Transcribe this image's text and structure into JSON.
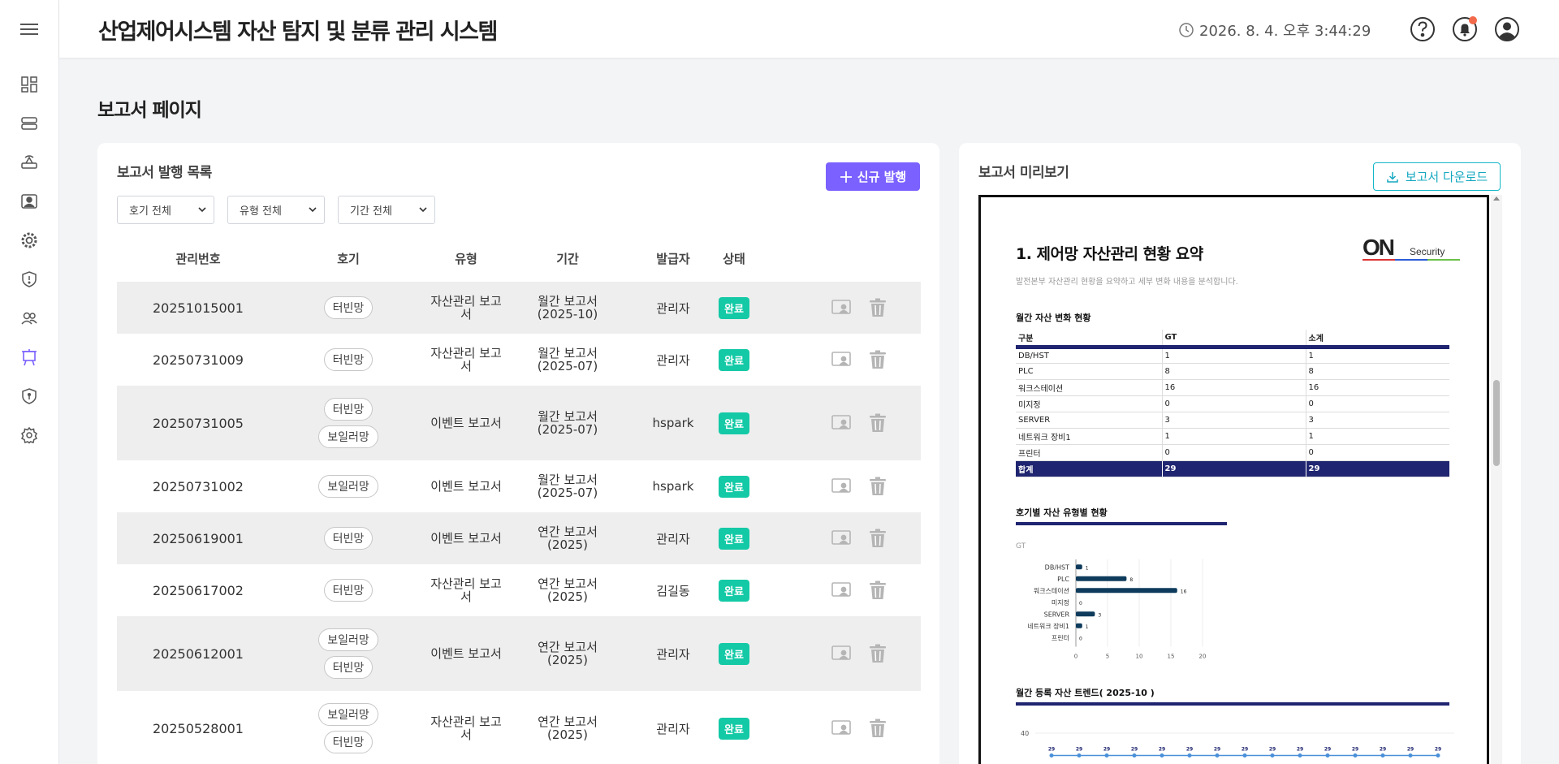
{
  "header": {
    "title": "산업제어시스템 자산 탐지 및 분류 관리 시스템",
    "datetime": "2026. 8. 4. 오후 3:44:29"
  },
  "sidebar": {
    "items": [
      {
        "icon": "dashboard-icon"
      },
      {
        "icon": "server-list-icon"
      },
      {
        "icon": "router-icon"
      },
      {
        "icon": "monitor-user-icon"
      },
      {
        "icon": "gear-cog-icon"
      },
      {
        "icon": "shield-alert-icon"
      },
      {
        "icon": "users-icon"
      },
      {
        "icon": "report-board-icon",
        "active": true
      },
      {
        "icon": "shield-info-icon"
      },
      {
        "icon": "settings-icon"
      }
    ],
    "active_color": "#7b61ff"
  },
  "page": {
    "title": "보고서 페이지"
  },
  "list_panel": {
    "title": "보고서 발행 목록",
    "new_button": "신규 발행",
    "filters": [
      "호기 전체",
      "유형 전체",
      "기간 전체"
    ],
    "columns": [
      "관리번호",
      "호기",
      "유형",
      "기간",
      "발급자",
      "상태"
    ],
    "rows": [
      {
        "id": "20251015001",
        "plants": [
          "터빈망"
        ],
        "type": [
          "자산관리 보고",
          "서"
        ],
        "period": [
          "월간 보고서",
          "(2025-10)"
        ],
        "issuer": "관리자",
        "status": "완료"
      },
      {
        "id": "20250731009",
        "plants": [
          "터빈망"
        ],
        "type": [
          "자산관리 보고",
          "서"
        ],
        "period": [
          "월간 보고서",
          "(2025-07)"
        ],
        "issuer": "관리자",
        "status": "완료"
      },
      {
        "id": "20250731005",
        "plants": [
          "터빈망",
          "보일러망"
        ],
        "type": [
          "이벤트 보고서"
        ],
        "period": [
          "월간 보고서",
          "(2025-07)"
        ],
        "issuer": "hspark",
        "status": "완료"
      },
      {
        "id": "20250731002",
        "plants": [
          "보일러망"
        ],
        "type": [
          "이벤트 보고서"
        ],
        "period": [
          "월간 보고서",
          "(2025-07)"
        ],
        "issuer": "hspark",
        "status": "완료"
      },
      {
        "id": "20250619001",
        "plants": [
          "터빈망"
        ],
        "type": [
          "이벤트 보고서"
        ],
        "period": [
          "연간 보고서",
          "(2025)"
        ],
        "issuer": "관리자",
        "status": "완료"
      },
      {
        "id": "20250617002",
        "plants": [
          "터빈망"
        ],
        "type": [
          "자산관리 보고",
          "서"
        ],
        "period": [
          "연간 보고서",
          "(2025)"
        ],
        "issuer": "김길동",
        "status": "완료"
      },
      {
        "id": "20250612001",
        "plants": [
          "보일러망",
          "터빈망"
        ],
        "type": [
          "이벤트 보고서"
        ],
        "period": [
          "연간 보고서",
          "(2025)"
        ],
        "issuer": "관리자",
        "status": "완료"
      },
      {
        "id": "20250528001",
        "plants": [
          "보일러망",
          "터빈망"
        ],
        "type": [
          "자산관리 보고",
          "서"
        ],
        "period": [
          "연간 보고서",
          "(2025)"
        ],
        "issuer": "관리자",
        "status": "완료"
      }
    ]
  },
  "preview_panel": {
    "title": "보고서 미리보기",
    "download_button": "보고서 다운로드",
    "doc": {
      "heading": "1. 제어망 자산관리 현황 요약",
      "description": "발전본부 자산관리 현황을 요약하고 세부 변화 내용을 분석합니다.",
      "logo_main": "ON",
      "logo_sub": "Security",
      "section1_title": "월간 자산 변화 현황",
      "table_headers": [
        "구분",
        "GT",
        "소계"
      ],
      "table_rows": [
        [
          "DB/HST",
          "1",
          "1"
        ],
        [
          "PLC",
          "8",
          "8"
        ],
        [
          "워크스테이션",
          "16",
          "16"
        ],
        [
          "미지정",
          "0",
          "0"
        ],
        [
          "SERVER",
          "3",
          "3"
        ],
        [
          "네트워크 장비1",
          "1",
          "1"
        ],
        [
          "프린터",
          "0",
          "0"
        ]
      ],
      "table_total": [
        "합계",
        "29",
        "29"
      ],
      "section2_title": "호기별 자산 유형별 현황",
      "section3_title": "월간 등록 자산 트렌드( 2025-10 )"
    }
  },
  "chart_data": [
    {
      "type": "bar",
      "orientation": "horizontal",
      "title": "GT",
      "categories": [
        "DB/HST",
        "PLC",
        "워크스테이션",
        "미지정",
        "SERVER",
        "네트워크 장비1",
        "프린터"
      ],
      "values": [
        1,
        8,
        16,
        0,
        3,
        1,
        0
      ],
      "xticks": [
        "0",
        "5",
        "10",
        "15",
        "20"
      ],
      "xlim": [
        0,
        20
      ],
      "color": "#0e3b5c"
    },
    {
      "type": "line",
      "y_tick": "40",
      "values": [
        29,
        29,
        29,
        29,
        29,
        29,
        29,
        29,
        29,
        29,
        29,
        29,
        29,
        29,
        29
      ],
      "ylim": [
        0,
        40
      ],
      "color": "#4a90d9"
    }
  ]
}
